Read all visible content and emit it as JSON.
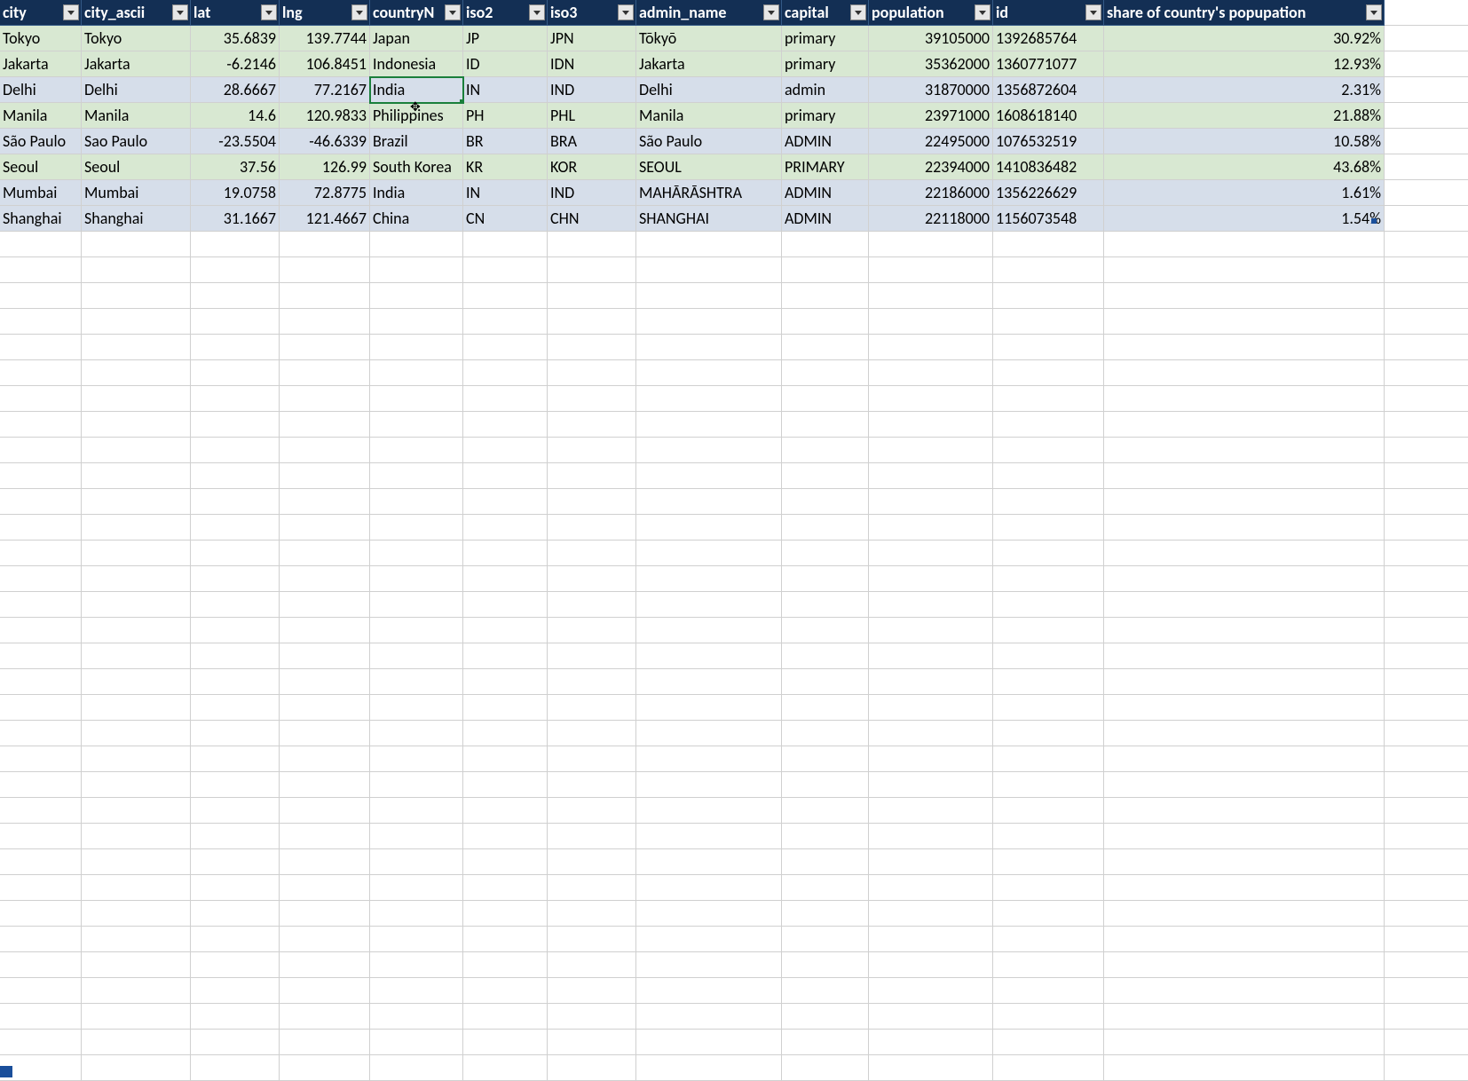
{
  "columns": [
    {
      "key": "city",
      "label": "city",
      "align": "txt"
    },
    {
      "key": "city_ascii",
      "label": "city_ascii",
      "align": "txt"
    },
    {
      "key": "lat",
      "label": "lat",
      "align": "num"
    },
    {
      "key": "lng",
      "label": "lng",
      "align": "num"
    },
    {
      "key": "countryName",
      "label": "countryN",
      "align": "txt"
    },
    {
      "key": "iso2",
      "label": "iso2",
      "align": "txt"
    },
    {
      "key": "iso3",
      "label": "iso3",
      "align": "txt"
    },
    {
      "key": "admin_name",
      "label": "admin_name",
      "align": "txt"
    },
    {
      "key": "capital",
      "label": "capital",
      "align": "txt"
    },
    {
      "key": "population",
      "label": "population",
      "align": "num"
    },
    {
      "key": "id",
      "label": "id",
      "align": "txt"
    },
    {
      "key": "share",
      "label": "share of country's popupation",
      "align": "num"
    }
  ],
  "rows": [
    {
      "band": "green",
      "city": "Tokyo",
      "city_ascii": "Tokyo",
      "lat": "35.6839",
      "lng": "139.7744",
      "countryName": "Japan",
      "iso2": "JP",
      "iso3": "JPN",
      "admin_name": "Tōkyō",
      "capital": "primary",
      "population": "39105000",
      "id": "1392685764",
      "share": "30.92%"
    },
    {
      "band": "green",
      "city": "Jakarta",
      "city_ascii": "Jakarta",
      "lat": "-6.2146",
      "lng": "106.8451",
      "countryName": "Indonesia",
      "iso2": "ID",
      "iso3": "IDN",
      "admin_name": "Jakarta",
      "capital": "primary",
      "population": "35362000",
      "id": "1360771077",
      "share": "12.93%"
    },
    {
      "band": "blue",
      "city": "Delhi",
      "city_ascii": "Delhi",
      "lat": "28.6667",
      "lng": "77.2167",
      "countryName": "India",
      "iso2": "IN",
      "iso3": "IND",
      "admin_name": "Delhi",
      "capital": "admin",
      "population": "31870000",
      "id": "1356872604",
      "share": "2.31%"
    },
    {
      "band": "green",
      "city": "Manila",
      "city_ascii": "Manila",
      "lat": "14.6",
      "lng": "120.9833",
      "countryName": "Philippines",
      "iso2": "PH",
      "iso3": "PHL",
      "admin_name": "Manila",
      "capital": "primary",
      "population": "23971000",
      "id": "1608618140",
      "share": "21.88%"
    },
    {
      "band": "blue",
      "city": "São Paulo",
      "city_ascii": "Sao Paulo",
      "lat": "-23.5504",
      "lng": "-46.6339",
      "countryName": "Brazil",
      "iso2": "BR",
      "iso3": "BRA",
      "admin_name": "São Paulo",
      "capital": "ADMIN",
      "population": "22495000",
      "id": "1076532519",
      "share": "10.58%"
    },
    {
      "band": "green",
      "city": "Seoul",
      "city_ascii": "Seoul",
      "lat": "37.56",
      "lng": "126.99",
      "countryName": "South Korea",
      "iso2": "KR",
      "iso3": "KOR",
      "admin_name": "SEOUL",
      "capital": "PRIMARY",
      "population": "22394000",
      "id": "1410836482",
      "share": "43.68%"
    },
    {
      "band": "blue",
      "city": "Mumbai",
      "city_ascii": "Mumbai",
      "lat": "19.0758",
      "lng": "72.8775",
      "countryName": "India",
      "iso2": "IN",
      "iso3": "IND",
      "admin_name": "MAHĀRĀSHTRA",
      "capital": "ADMIN",
      "population": "22186000",
      "id": "1356226629",
      "share": "1.61%"
    },
    {
      "band": "blue",
      "city": "Shanghai",
      "city_ascii": "Shanghai",
      "lat": "31.1667",
      "lng": "121.4667",
      "countryName": "China",
      "iso2": "CN",
      "iso3": "CHN",
      "admin_name": "SHANGHAI",
      "capital": "ADMIN",
      "population": "22118000",
      "id": "1156073548",
      "share": "1.54%"
    }
  ],
  "selected_cell": {
    "row": 2,
    "col": "countryName"
  },
  "empty_rows": 33
}
